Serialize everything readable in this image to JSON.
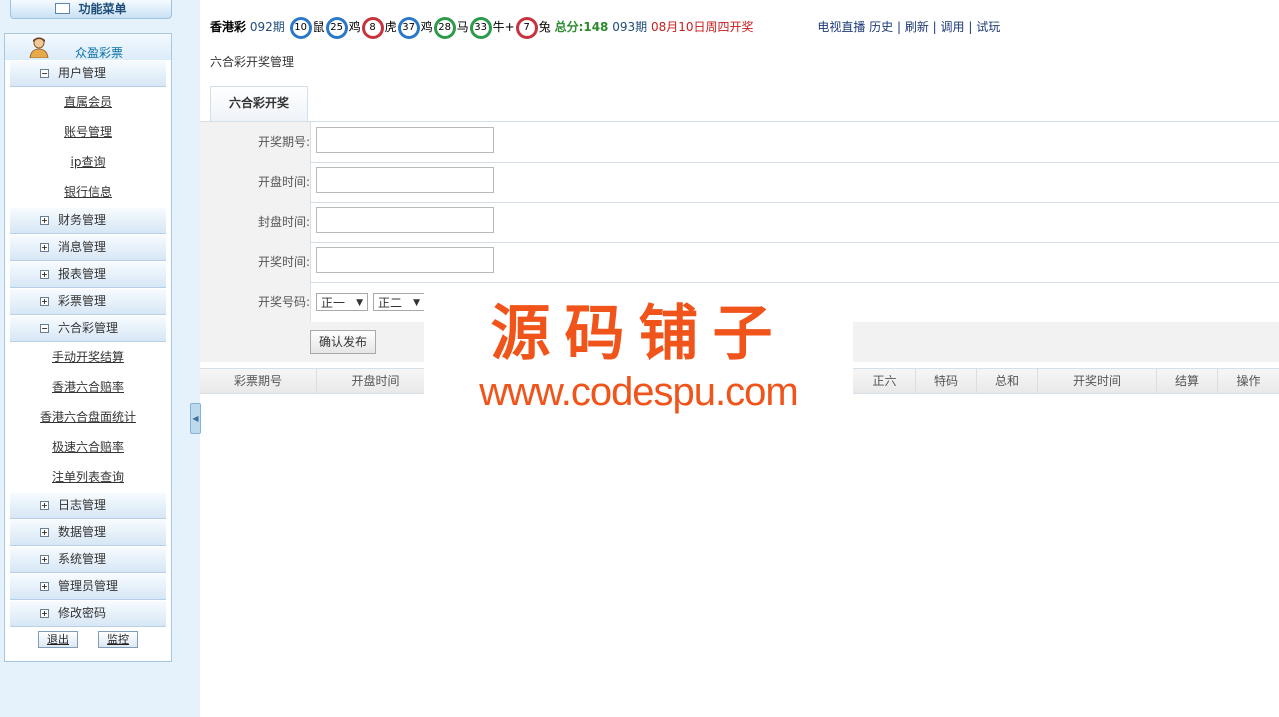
{
  "sidebar": {
    "title": "功能菜单",
    "user": "众盈彩票",
    "groups": [
      {
        "label": "用户管理",
        "toggle": "−"
      },
      {
        "label": "财务管理",
        "toggle": "+"
      },
      {
        "label": "消息管理",
        "toggle": "+"
      },
      {
        "label": "报表管理",
        "toggle": "+"
      },
      {
        "label": "彩票管理",
        "toggle": "+"
      },
      {
        "label": "六合彩管理",
        "toggle": "−"
      },
      {
        "label": "日志管理",
        "toggle": "+"
      },
      {
        "label": "数据管理",
        "toggle": "+"
      },
      {
        "label": "系统管理",
        "toggle": "+"
      },
      {
        "label": "管理员管理",
        "toggle": "+"
      },
      {
        "label": "修改密码",
        "toggle": "+"
      }
    ],
    "user_items": [
      "直属会员",
      "账号管理",
      "ip查询",
      "银行信息"
    ],
    "lhc_items": [
      "手动开奖结算",
      "香港六合赔率",
      "香港六合盘面统计",
      "极速六合赔率",
      "注单列表查询"
    ],
    "logout_label": "退出",
    "monitor_label": "监控"
  },
  "topbar": {
    "lottery": "香港彩",
    "period": "092期",
    "balls": [
      {
        "num": "10",
        "zodiac": "鼠",
        "color": "#2a79c8"
      },
      {
        "num": "25",
        "zodiac": "鸡",
        "color": "#2a79c8"
      },
      {
        "num": "8",
        "zodiac": "虎",
        "color": "#c8323c"
      },
      {
        "num": "37",
        "zodiac": "鸡",
        "color": "#2a79c8"
      },
      {
        "num": "28",
        "zodiac": "马",
        "color": "#2b9a4a"
      },
      {
        "num": "33",
        "zodiac": "牛+",
        "color": "#2b9a4a"
      },
      {
        "num": "7",
        "zodiac": "兔",
        "color": "#c8323c"
      }
    ],
    "total": "总分:148",
    "next_period": "093期",
    "next_date": "08月10日周四开奖",
    "links": "电视直播  历史 | 刷新 | 调用 | 试玩"
  },
  "breadcrumb": "六合彩开奖管理",
  "tab_label": "六合彩开奖",
  "form": {
    "period_label": "开奖期号:",
    "open_label": "开盘时间:",
    "close_label": "封盘时间:",
    "draw_label": "开奖时间:",
    "number_label": "开奖号码:",
    "select1": "正一",
    "select2": "正二",
    "submit_label": "确认发布"
  },
  "table_headers": {
    "period": "彩票期号",
    "open_time": "开盘时间",
    "z6": "正六",
    "special": "特码",
    "sum": "总和",
    "draw_time": "开奖时间",
    "settle": "结算",
    "action": "操作"
  },
  "watermark": {
    "cn": "源码铺子",
    "en": "www.codespu.com"
  }
}
